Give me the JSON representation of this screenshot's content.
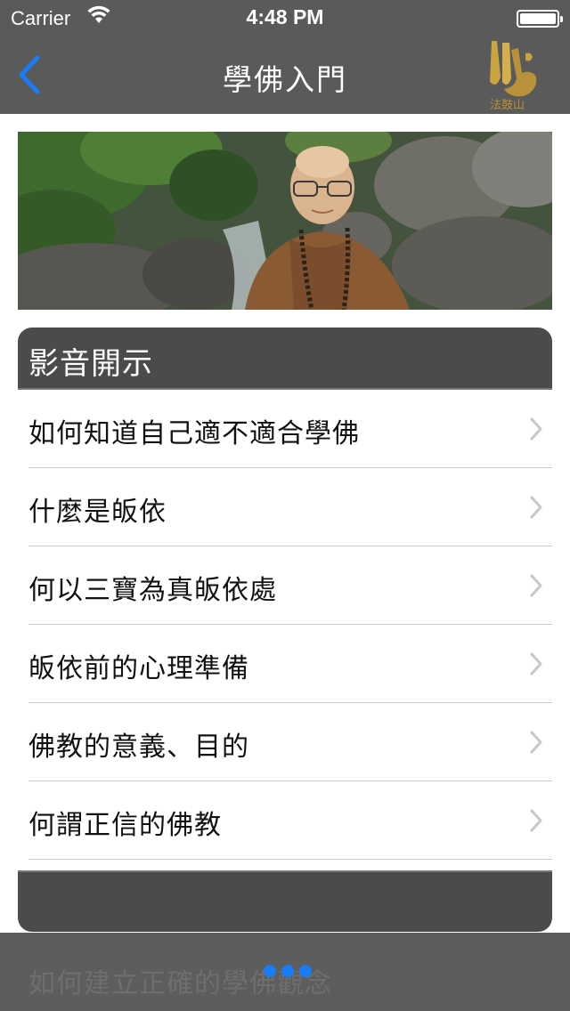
{
  "status_bar": {
    "carrier": "Carrier",
    "time": "4:48 PM",
    "battery_level": 1.0
  },
  "nav": {
    "title": "學佛入門",
    "back_icon": "chevron-left-icon",
    "logo_text": "法鼓山",
    "accent_color": "#1a7cf5"
  },
  "banner": {
    "description_icon": "portrait-photo"
  },
  "section": {
    "header": "影音開示",
    "items": [
      {
        "label": "如何知道自己適不適合學佛"
      },
      {
        "label": "什麼是皈依"
      },
      {
        "label": "何以三寶為真皈依處"
      },
      {
        "label": "皈依前的心理準備"
      },
      {
        "label": "佛教的意義、目的"
      },
      {
        "label": "何謂正信的佛教"
      }
    ]
  },
  "bottom": {
    "ghost_text": "如何建立正確的學佛觀念",
    "page_dots": 3
  }
}
